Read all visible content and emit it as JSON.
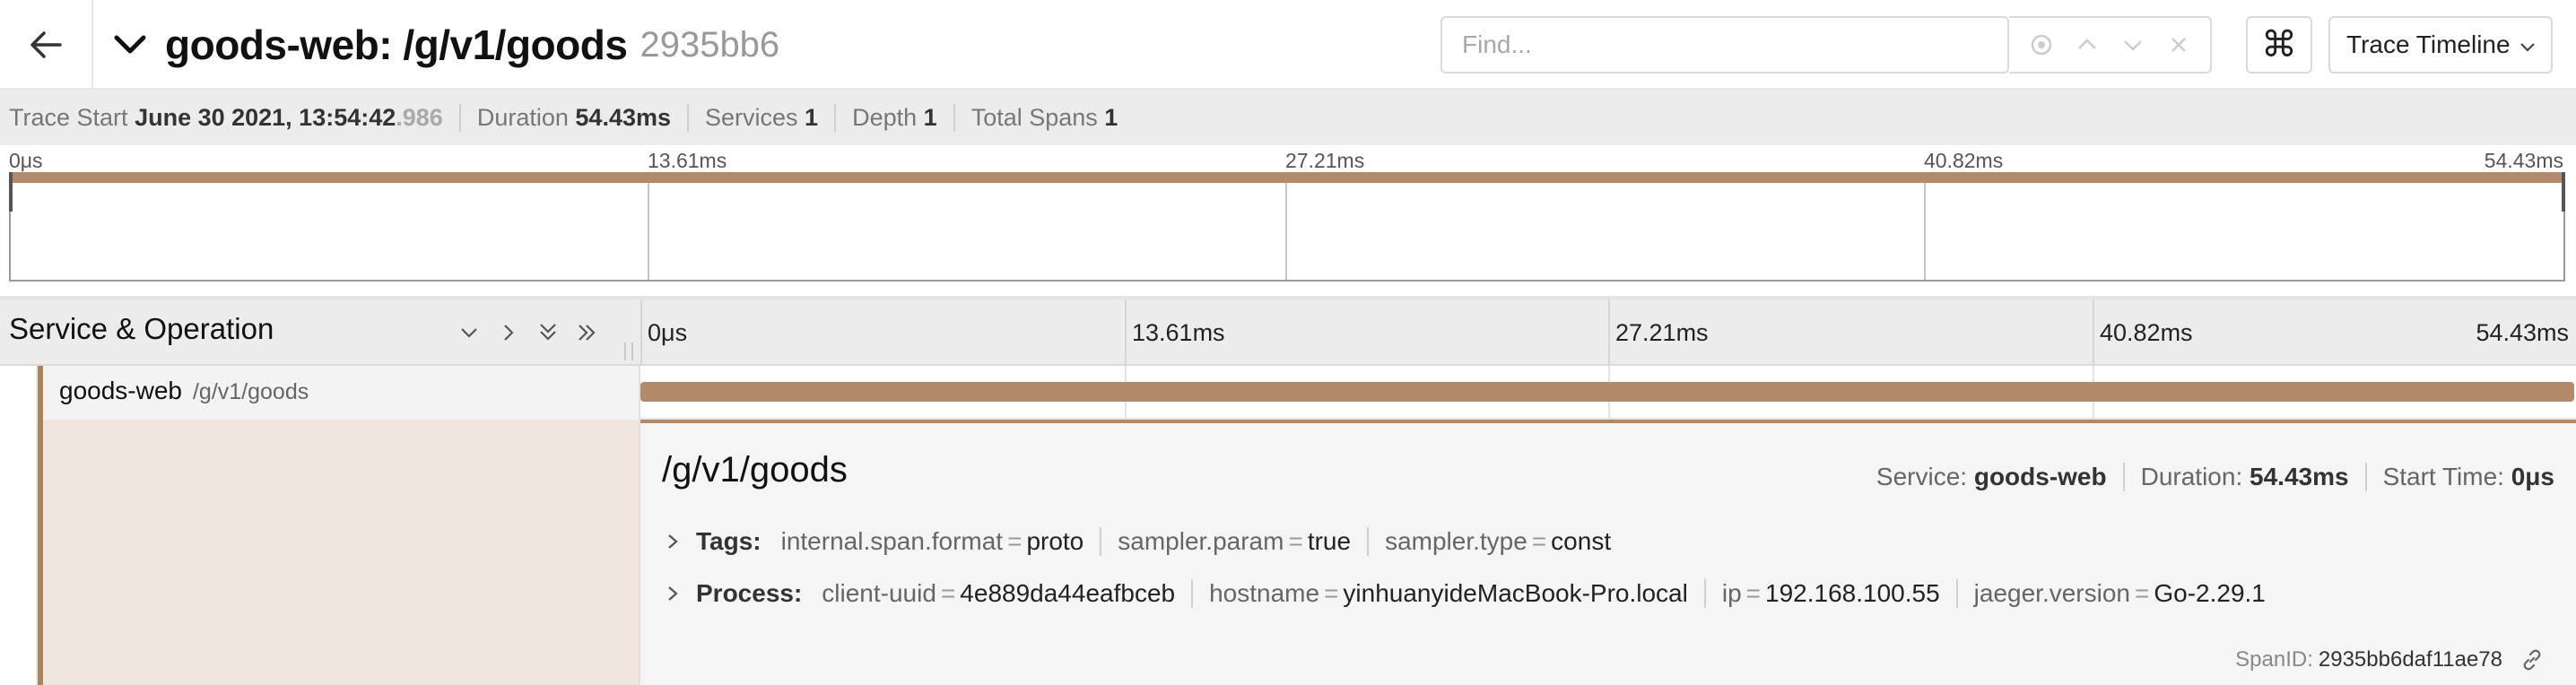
{
  "header": {
    "title": "goods-web: /g/v1/goods",
    "trace_id_short": "2935bb6",
    "find_placeholder": "Find...",
    "keyboard_shortcut_glyph": "⌘",
    "view_mode": "Trace Timeline"
  },
  "meta": {
    "trace_start_label": "Trace Start",
    "trace_start_value": "June 30 2021, 13:54:42",
    "trace_start_ms": ".986",
    "duration_label": "Duration",
    "duration_value": "54.43ms",
    "services_label": "Services",
    "services_value": "1",
    "depth_label": "Depth",
    "depth_value": "1",
    "total_spans_label": "Total Spans",
    "total_spans_value": "1"
  },
  "minimap": {
    "ticks": [
      "0μs",
      "13.61ms",
      "27.21ms",
      "40.82ms",
      "54.43ms"
    ]
  },
  "span_header": {
    "title": "Service & Operation",
    "ticks": [
      "0μs",
      "13.61ms",
      "27.21ms",
      "40.82ms",
      "54.43ms"
    ]
  },
  "span_row": {
    "service": "goods-web",
    "operation": "/g/v1/goods",
    "start_fraction": 0.0,
    "duration_fraction": 1.0
  },
  "detail": {
    "title": "/g/v1/goods",
    "service_label": "Service:",
    "service_value": "goods-web",
    "duration_label": "Duration:",
    "duration_value": "54.43ms",
    "start_label": "Start Time:",
    "start_value": "0μs",
    "tags_label": "Tags:",
    "tags": [
      {
        "key": "internal.span.format",
        "value": "proto"
      },
      {
        "key": "sampler.param",
        "value": "true"
      },
      {
        "key": "sampler.type",
        "value": "const"
      }
    ],
    "process_label": "Process:",
    "process": [
      {
        "key": "client-uuid",
        "value": "4e889da44eafbceb"
      },
      {
        "key": "hostname",
        "value": "yinhuanyideMacBook-Pro.local"
      },
      {
        "key": "ip",
        "value": "192.168.100.55"
      },
      {
        "key": "jaeger.version",
        "value": "Go-2.29.1"
      }
    ],
    "span_id_label": "SpanID:",
    "span_id_value": "2935bb6daf11ae78"
  },
  "colors": {
    "span_color": "#b08a6a",
    "detail_left_bg": "#f0e6df"
  },
  "icons": {
    "back": "arrow-left-icon",
    "collapse": "chevron-down-icon",
    "find_tools": [
      "target-icon",
      "chevron-up-icon",
      "chevron-down-icon",
      "close-icon"
    ],
    "span_controls": [
      "chevron-down-icon",
      "chevron-right-icon",
      "double-chevron-down-icon",
      "double-chevron-right-icon"
    ],
    "link": "link-icon"
  }
}
